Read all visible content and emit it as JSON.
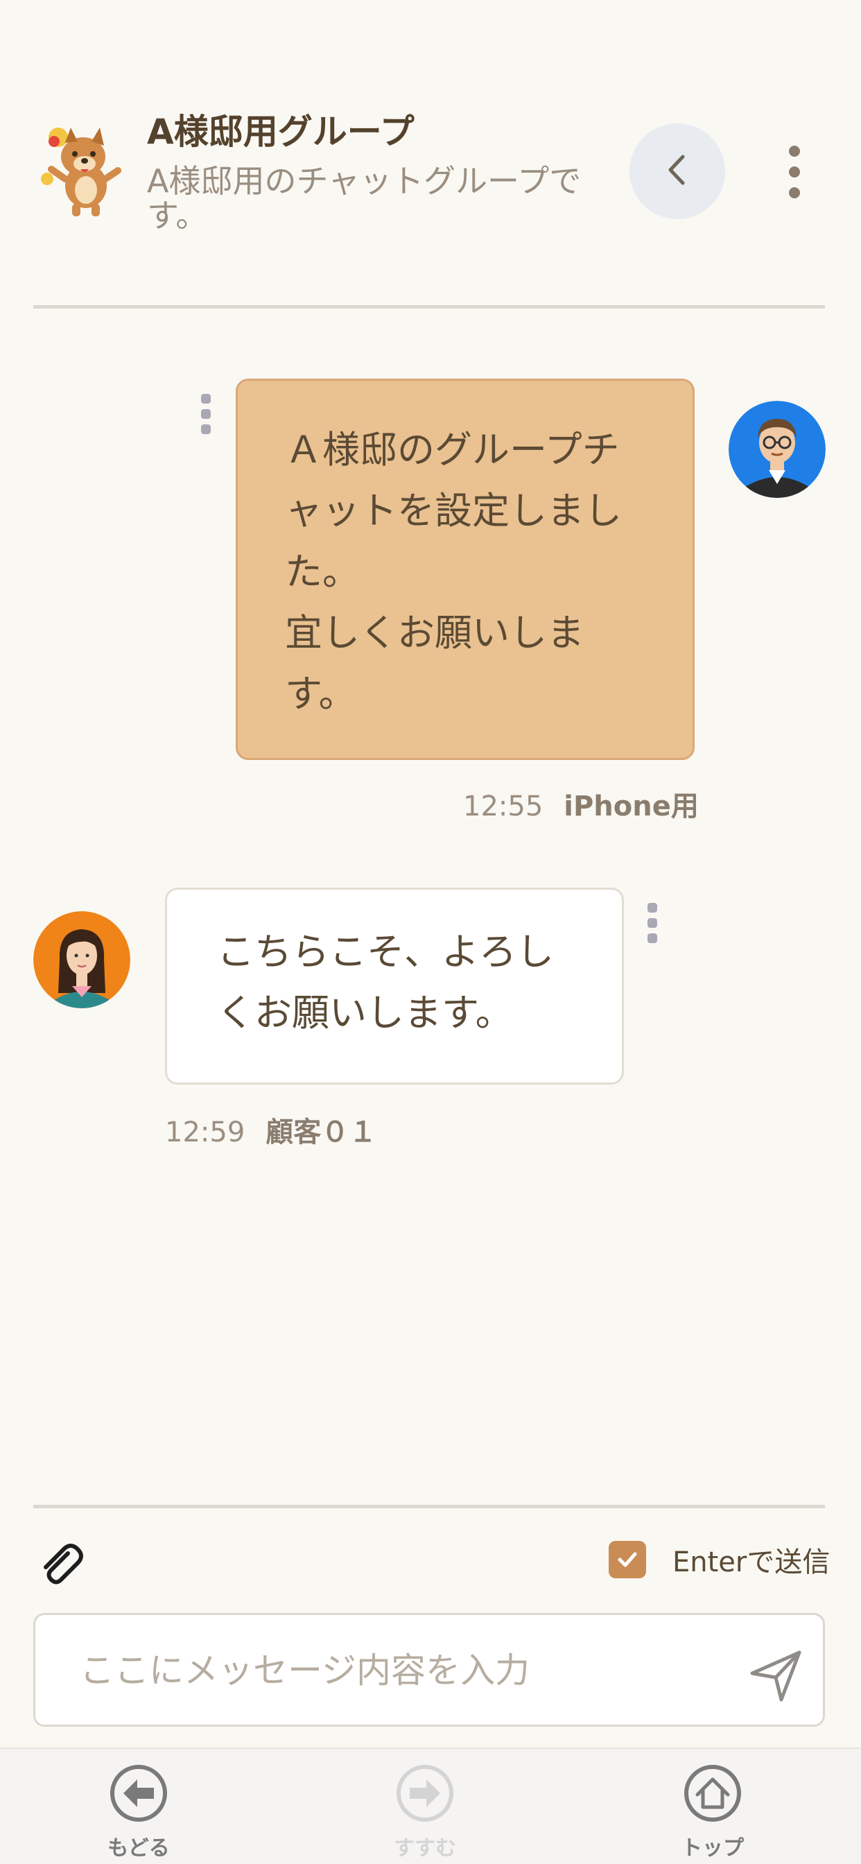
{
  "header": {
    "group_name": "A様邸用グループ",
    "group_description": "A様邸用のチャットグループです。",
    "avatar_icon": "mascot-dog-icon",
    "back_icon": "chevron-left-icon",
    "menu_icon": "more-vertical-icon"
  },
  "messages": [
    {
      "direction": "outgoing",
      "lines": [
        "Ａ様邸のグループチ",
        "ャットを設定しまし",
        "た。",
        "宜しくお願いしま",
        "す。"
      ],
      "time": "12:55",
      "sender": "iPhone用",
      "bubble_color": "#eac190"
    },
    {
      "direction": "incoming",
      "lines": [
        "こちらこそ、よろし",
        "くお願いします。"
      ],
      "time": "12:59",
      "sender": "顧客０１",
      "bubble_color": "#ffffff"
    }
  ],
  "composer": {
    "enter_to_send_label": "Enterで送信",
    "enter_to_send_checked": true,
    "placeholder": "ここにメッセージ内容を入力",
    "value": "",
    "attach_icon": "paperclip-icon",
    "send_icon": "send-icon"
  },
  "bottom_nav": {
    "back_label": "もどる",
    "forward_label": "すすむ",
    "top_label": "トップ"
  },
  "colors": {
    "accent": "#c98c55",
    "background": "#faf8f3",
    "text": "#5a4a35"
  }
}
